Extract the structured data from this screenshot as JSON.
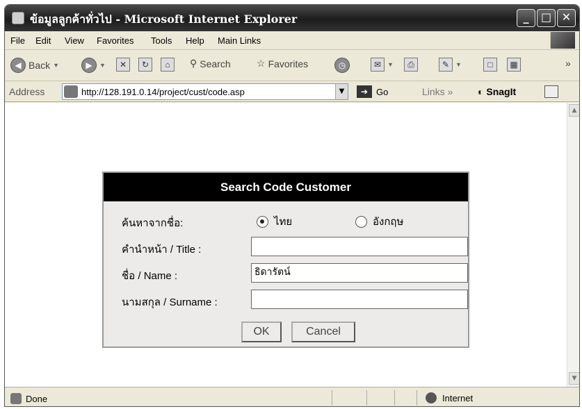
{
  "window": {
    "title": "ข้อมูลลูกค้าทั่วไป - Microsoft Internet Explorer"
  },
  "menu": [
    "File",
    "Edit",
    "View",
    "Favorites",
    "Tools",
    "Help",
    "Main Links"
  ],
  "toolbar": {
    "back": "Back",
    "search": "Search",
    "favorites": "Favorites"
  },
  "address": {
    "label": "Address",
    "url": "http://128.191.0.14/project/cust/code.asp",
    "go": "Go",
    "links": "Links",
    "snagit": "SnagIt"
  },
  "dialog": {
    "title": "Search Code Customer",
    "search_by_label": "ค้นหาจากชื่อ:",
    "radio_thai": "ไทย",
    "radio_english": "อังกฤษ",
    "title_label": "คำนำหน้า / Title :",
    "title_value": "",
    "name_label": "ชื่อ / Name :",
    "name_value": "ธิดารัตน์",
    "surname_label": "นามสกุล / Surname :",
    "surname_value": "",
    "ok": "OK",
    "cancel": "Cancel"
  },
  "status": {
    "text": "Done",
    "zone": "Internet"
  },
  "colors": {
    "dialog_header": "#000000",
    "title_bar": "#2a2a2a",
    "chrome": "#ece9d8"
  },
  "icons": [
    "ie-page-icon",
    "minimize-icon",
    "maximize-icon",
    "close-icon",
    "back-icon",
    "forward-icon",
    "stop-icon",
    "refresh-icon",
    "home-icon",
    "search-icon",
    "favorites-star-icon",
    "history-icon",
    "mail-icon",
    "print-icon",
    "edit-icon",
    "discuss-icon",
    "research-icon",
    "go-arrow-icon",
    "snagit-icon",
    "globe-icon"
  ]
}
